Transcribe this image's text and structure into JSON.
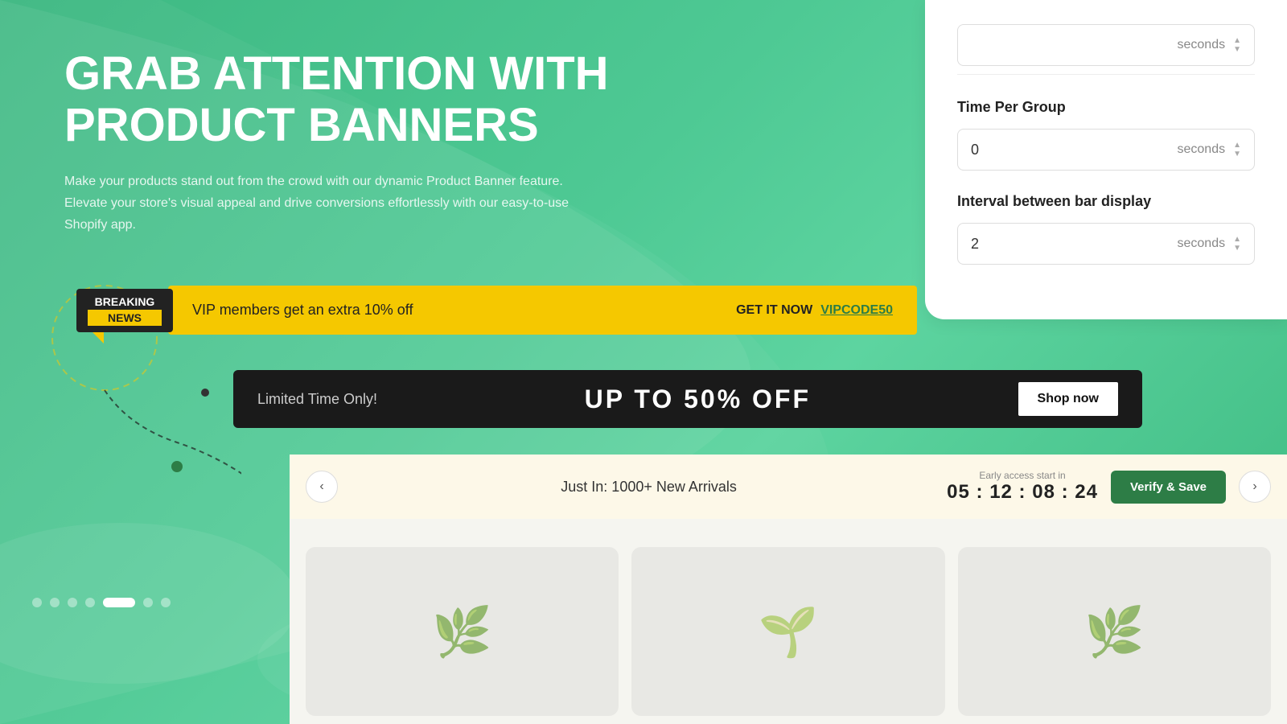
{
  "settings": {
    "time_per_group": {
      "label": "Time Per Group",
      "value": "0",
      "unit": "seconds"
    },
    "interval": {
      "label": "Interval between bar display",
      "value": "2",
      "unit": "seconds"
    },
    "top_unit": "seconds"
  },
  "hero": {
    "title_line1": "GRAB ATTENTION WITH",
    "title_line2": "PRODUCT BANNERS",
    "subtitle": "Make your products stand out from the crowd with our dynamic Product Banner feature. Elevate your store's visual appeal and drive conversions effortlessly with our easy-to-use Shopify app."
  },
  "breaking_banner": {
    "tag_line1": "BREAKING",
    "tag_line2": "NEWS",
    "message": "VIP members get an extra 10% off",
    "cta_label": "GET IT NOW",
    "code": "VIPCODE50"
  },
  "dark_banner": {
    "limited": "Limited Time Only!",
    "sale": "UP TO 50% OFF",
    "button": "Shop now"
  },
  "arrivals_banner": {
    "message": "Just In: 1000+ New Arrivals",
    "early_label": "Early access start in",
    "countdown": "05 : 12 : 08 : 24",
    "verify_button": "Verify & Save"
  },
  "pagination": {
    "total": 7,
    "active": 5
  }
}
